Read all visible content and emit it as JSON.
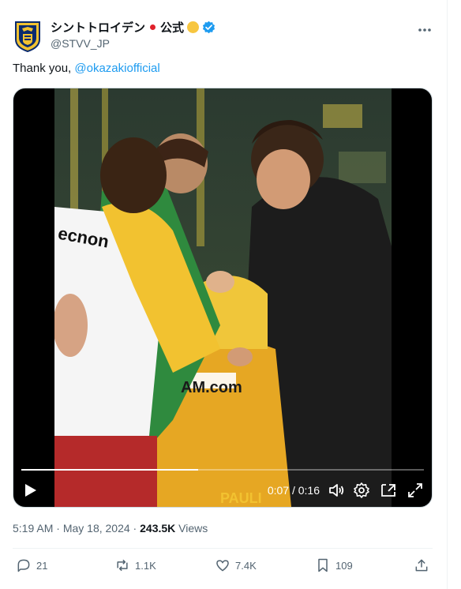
{
  "account": {
    "name": "シントトロイデン",
    "official": "公式",
    "handle": "@STVV_JP",
    "avatar_icon": "club-crest-icon",
    "verified_icon": "verified-badge-icon"
  },
  "tweet": {
    "text_prefix": "Thank you, ",
    "mention": "@okazakiofficial"
  },
  "video": {
    "time": "0:07 / 0:16",
    "progress": 0.44,
    "jersey_text_1": "AM.com",
    "jersey_text_2": "PAULI",
    "bib_text": "ecnon"
  },
  "meta": {
    "time": "5:19 AM",
    "date": "May 18, 2024",
    "views_count": "243.5K",
    "views_label": "Views",
    "sep1": " · ",
    "sep2": " · "
  },
  "actions": {
    "replies": "21",
    "reposts": "1.1K",
    "likes": "7.4K",
    "bookmarks": "109"
  },
  "colors": {
    "accent": "#1d9bf0",
    "muted": "#536471",
    "text": "#0f1419"
  }
}
